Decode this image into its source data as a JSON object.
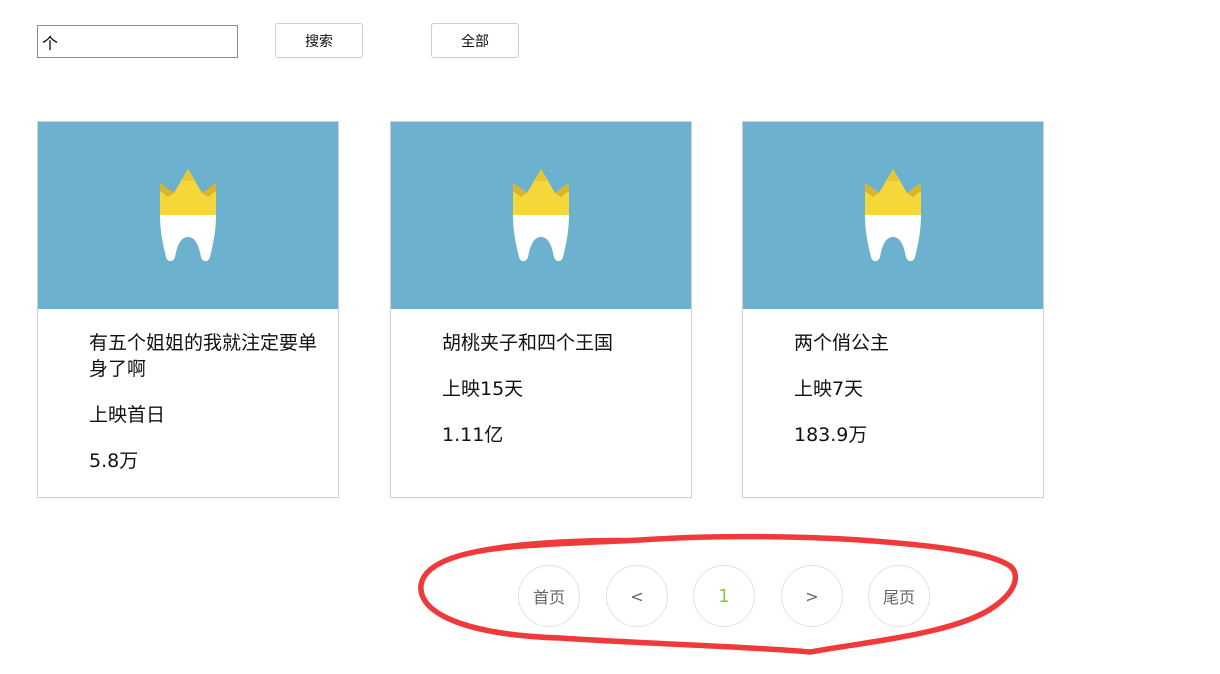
{
  "toolbar": {
    "search_value": "个",
    "search_label": "搜索",
    "all_label": "全部"
  },
  "movies": [
    {
      "title": "有五个姐姐的我就注定要单身了啊",
      "release": "上映首日",
      "box_office": "5.8万"
    },
    {
      "title": "胡桃夹子和四个王国",
      "release": "上映15天",
      "box_office": "1.11亿"
    },
    {
      "title": "两个俏公主",
      "release": "上映7天",
      "box_office": "183.9万"
    }
  ],
  "pagination": {
    "first": "首页",
    "prev": "<",
    "current": "1",
    "next": ">",
    "last": "尾页"
  },
  "colors": {
    "poster_bg": "#6cb1cd",
    "crown": "#f6d73a",
    "crown_shade": "#d9b52b",
    "tooth": "#ffffff",
    "active_page": "#8cc63f",
    "annotation": "#f03a3a"
  },
  "icons": {
    "poster_placeholder": "tooth-crown-icon"
  }
}
